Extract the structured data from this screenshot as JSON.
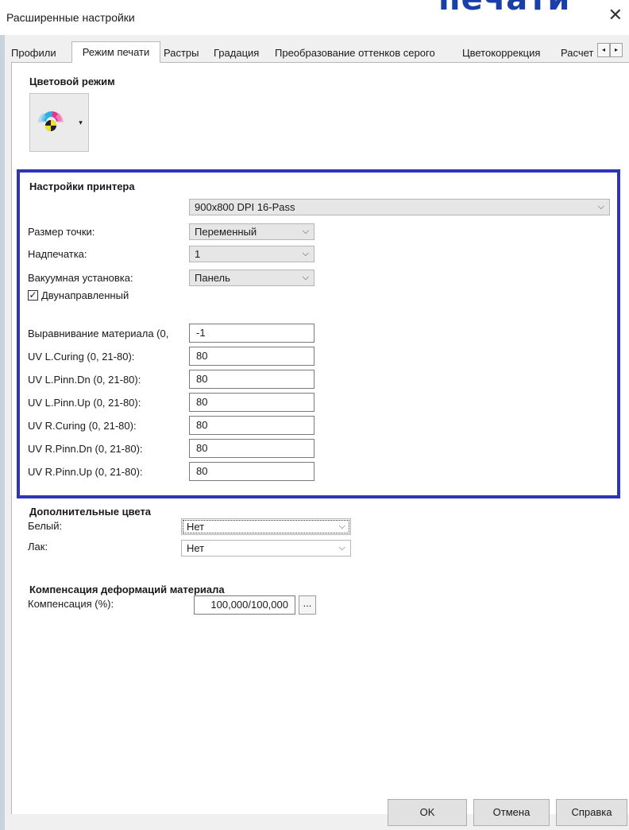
{
  "window": {
    "title": "Расширенные настройки",
    "close": "✕",
    "overlay_text": "печати"
  },
  "tabs": [
    {
      "label": "Профили",
      "active": false
    },
    {
      "label": "Режим печати",
      "active": true
    },
    {
      "label": "Растры",
      "active": false
    },
    {
      "label": "Градация",
      "active": false
    },
    {
      "label": "Преобразование оттенков серого",
      "active": false
    },
    {
      "label": "Цветокоррекция",
      "active": false
    },
    {
      "label": "Расчет",
      "active": false
    }
  ],
  "tab_scroll": {
    "left": "◂",
    "right": "▸"
  },
  "color_mode": {
    "title": "Цветовой режим",
    "icon": "cmyk-color-wheel-icon",
    "dropdown_arrow": "▾"
  },
  "printer_settings": {
    "title": "Настройки принтера",
    "resolution": "900x800 DPI 16-Pass",
    "dot_size_label": "Размер точки:",
    "dot_size_value": "Переменный",
    "overprint_label": "Надпечатка:",
    "overprint_value": "1",
    "vacuum_label": "Вакуумная установка:",
    "vacuum_value": "Панель",
    "bidirectional_label": "Двунаправленный",
    "bidirectional_checked": true,
    "fields": [
      {
        "label": "Выравнивание материала (0,",
        "value": "-1"
      },
      {
        "label": "UV L.Curing (0, 21-80):",
        "value": "80"
      },
      {
        "label": "UV L.Pinn.Dn (0, 21-80):",
        "value": "80"
      },
      {
        "label": "UV L.Pinn.Up (0, 21-80):",
        "value": "80"
      },
      {
        "label": "UV R.Curing (0, 21-80):",
        "value": "80"
      },
      {
        "label": "UV R.Pinn.Dn (0, 21-80):",
        "value": "80"
      },
      {
        "label": "UV R.Pinn.Up (0, 21-80):",
        "value": "80"
      }
    ]
  },
  "extra_colors": {
    "title": "Дополнительные цвета",
    "white_label": "Белый:",
    "white_value": "Нет",
    "varnish_label": "Лак:",
    "varnish_value": "Нет"
  },
  "deformation": {
    "title": "Компенсация деформаций материала",
    "comp_label": "Компенсация (%):",
    "comp_value": "100,000/100,000",
    "more_button": "..."
  },
  "footer": {
    "ok": "OK",
    "cancel": "Отмена",
    "help": "Справка"
  },
  "chevron": "⌵",
  "colors": {
    "highlight_border": "#2d35b7",
    "overlay_text": "#1a3fa8"
  }
}
